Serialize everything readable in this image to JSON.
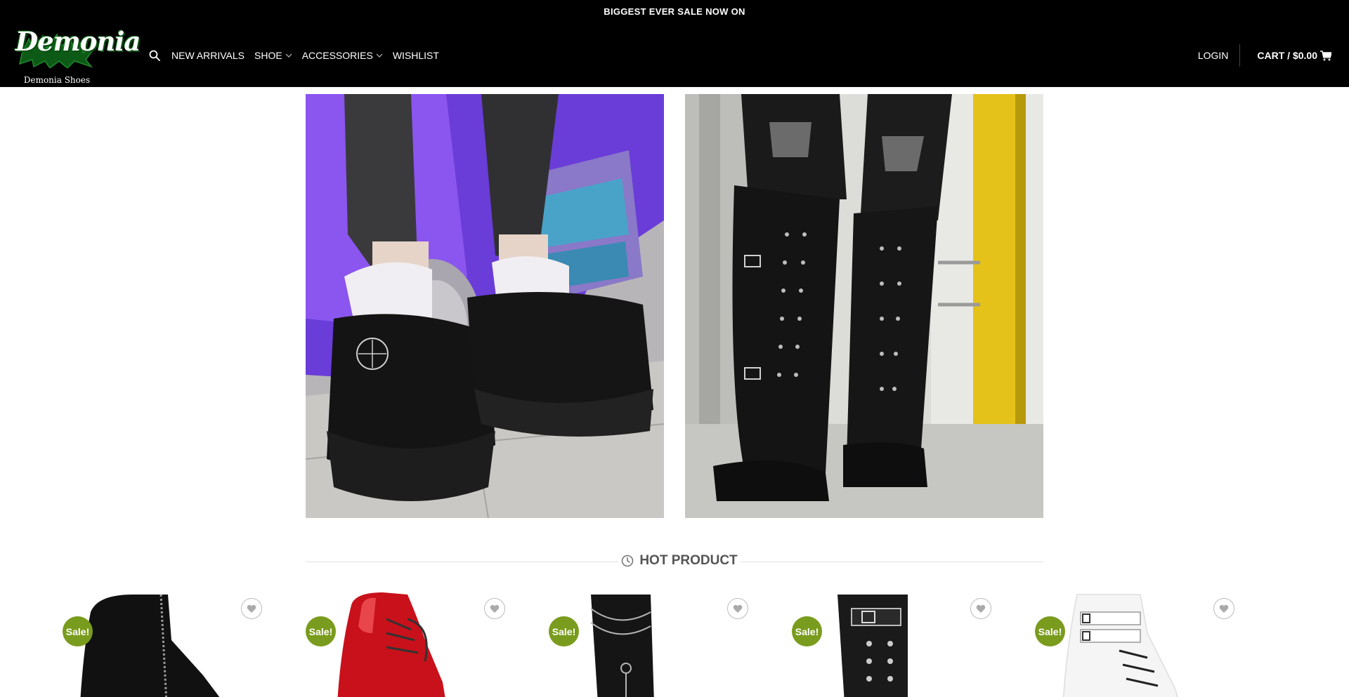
{
  "topbar": {
    "text": "BIGGEST EVER SALE NOW ON"
  },
  "logo": {
    "word": "Demonia",
    "subtitle": "Demonia Shoes"
  },
  "nav": {
    "items": [
      {
        "label": "NEW ARRIVALS"
      },
      {
        "label": "SHOE"
      },
      {
        "label": "ACCESSORIES"
      },
      {
        "label": "WISHLIST"
      }
    ]
  },
  "header_right": {
    "login": "LOGIN",
    "cart": "CART / $0.00"
  },
  "section": {
    "title": "HOT PRODUCT"
  },
  "products": [
    {
      "badge": "Sale!",
      "color": "#111111"
    },
    {
      "badge": "Sale!",
      "color": "#c8111a"
    },
    {
      "badge": "Sale!",
      "color": "#151515"
    },
    {
      "badge": "Sale!",
      "color": "#1a1a1a"
    },
    {
      "badge": "Sale!",
      "color": "#f4f4f4"
    }
  ],
  "colors": {
    "background": "#000000",
    "sale_badge": "#7a9c1e",
    "logo_green": "#1a7a24"
  }
}
